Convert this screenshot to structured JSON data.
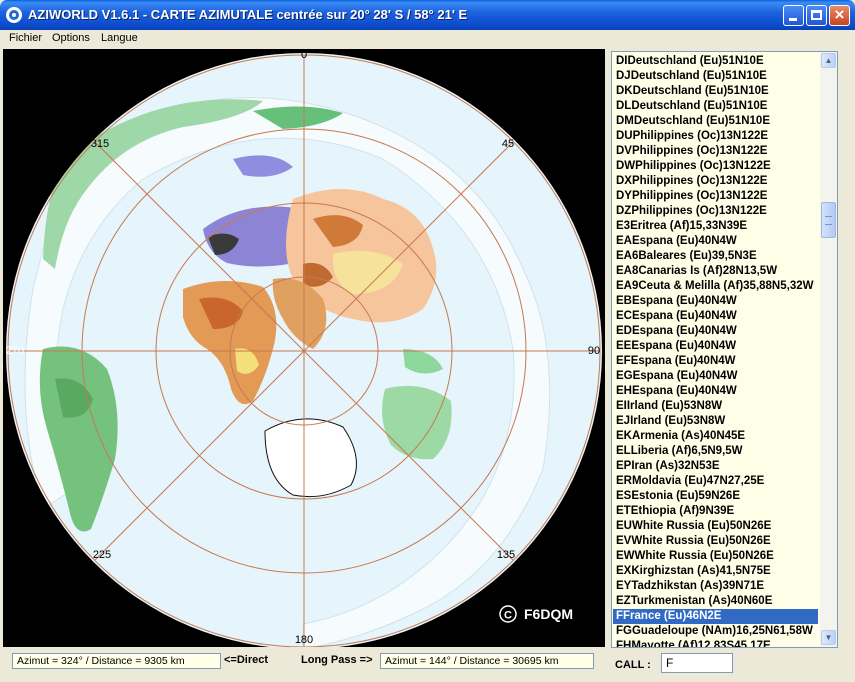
{
  "window": {
    "title": "AZIWORLD V1.6.1 - CARTE AZIMUTALE centrée sur 20° 28' S / 58° 21' E",
    "icon": "globe-icon"
  },
  "menu": {
    "items": [
      "Fichier",
      "Options",
      "Langue"
    ]
  },
  "map": {
    "azimuth_labels": [
      "0",
      "45",
      "90",
      "135",
      "180",
      "225",
      "270",
      "315"
    ],
    "copyright_symbol": "C",
    "copyright_text": "F6DQM",
    "colors": {
      "ocean": "#e6f4fb",
      "ring": "#c87850",
      "background": "#000000"
    }
  },
  "callsign_list": {
    "selected_index": 37,
    "items": [
      "DIDeutschland (Eu)51N10E",
      "DJDeutschland (Eu)51N10E",
      "DKDeutschland (Eu)51N10E",
      "DLDeutschland (Eu)51N10E",
      "DMDeutschland (Eu)51N10E",
      "DUPhilippines (Oc)13N122E",
      "DVPhilippines (Oc)13N122E",
      "DWPhilippines (Oc)13N122E",
      "DXPhilippines (Oc)13N122E",
      "DYPhilippines (Oc)13N122E",
      "DZPhilippines (Oc)13N122E",
      "E3Eritrea (Af)15,33N39E",
      "EAEspana (Eu)40N4W",
      "EA6Baleares (Eu)39,5N3E",
      "EA8Canarias Is (Af)28N13,5W",
      "EA9Ceuta & Melilla (Af)35,88N5,32W",
      "EBEspana (Eu)40N4W",
      "ECEspana (Eu)40N4W",
      "EDEspana (Eu)40N4W",
      "EEEspana (Eu)40N4W",
      "EFEspana (Eu)40N4W",
      "EGEspana (Eu)40N4W",
      "EHEspana (Eu)40N4W",
      "EIIrland (Eu)53N8W",
      "EJIrland (Eu)53N8W",
      "EKArmenia (As)40N45E",
      "ELLiberia (Af)6,5N9,5W",
      "EPIran (As)32N53E",
      "ERMoldavia (Eu)47N27,25E",
      "ESEstonia (Eu)59N26E",
      "ETEthiopia (Af)9N39E",
      "EUWhite Russia (Eu)50N26E",
      "EVWhite Russia (Eu)50N26E",
      "EWWhite Russia (Eu)50N26E",
      "EXKirghizstan (As)41,5N75E",
      "EYTadzhikstan (As)39N71E",
      "EZTurkmenistan (As)40N60E",
      "FFrance (Eu)46N2E",
      "FGGuadeloupe (NAm)16,25N61,58W",
      "FHMayotte (Af)12.83S45.17E"
    ]
  },
  "status": {
    "direct_box": "Azimut = 324° /  Distance = 9305 km",
    "direct_label": "<=Direct",
    "long_pass_label": "Long Pass =>",
    "long_box": "Azimut = 144° /  Distance = 30695 km",
    "call_label": "CALL :",
    "call_value": "F"
  }
}
